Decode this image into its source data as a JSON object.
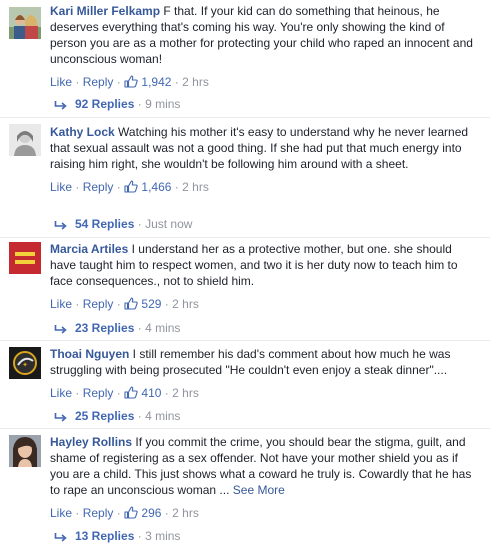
{
  "actions": {
    "like": "Like",
    "reply": "Reply",
    "dot": "·"
  },
  "comments": [
    {
      "author": "Kari Miller Felkamp",
      "text": " F that. If your kid can do something that heinous, he deserves everything that's coming his way. You're only showing the kind of person you are as a mother for protecting your child who raped an innocent and unconscious woman!",
      "likes": "1,942",
      "time": "2 hrs",
      "replies": "92 Replies",
      "replies_time": "9 mins"
    },
    {
      "author": "Kathy Lock",
      "text": " Watching his mother it's easy to understand why he never learned that sexual assault was not a good thing. If she had put that much energy into raising him right, she wouldn't be following him around with a sheet.",
      "likes": "1,466",
      "time": "2 hrs",
      "replies": "54 Replies",
      "replies_time": "Just now"
    },
    {
      "author": "Marcia Artiles",
      "text": " I understand her as a protective mother, but one. she should have taught him to respect women, and two it is her duty now to teach him to face consequences., not to shield him.",
      "likes": "529",
      "time": "2 hrs",
      "replies": "23 Replies",
      "replies_time": "4 mins"
    },
    {
      "author": "Thoai Nguyen",
      "text": " I still remember his dad's comment about how much he was struggling with being prosecuted \"He couldn't even enjoy a steak dinner\"....",
      "likes": "410",
      "time": "2 hrs",
      "replies": "25 Replies",
      "replies_time": "4 mins"
    },
    {
      "author": "Hayley Rollins",
      "text": " If you commit the crime, you should bear the stigma, guilt, and shame of registering as a sex offender. Not have your mother shield you as if you are a child. This just shows what a coward he truly is. Cowardly that he has to rape an unconscious woman ... ",
      "see_more": "See More",
      "likes": "296",
      "time": "2 hrs",
      "replies": "13 Replies",
      "replies_time": "3 mins"
    }
  ],
  "colors": {
    "link": "#365899",
    "action_link": "#4267b2",
    "meta": "#90949c",
    "text": "#1d2129",
    "divider": "#e9ebee"
  }
}
